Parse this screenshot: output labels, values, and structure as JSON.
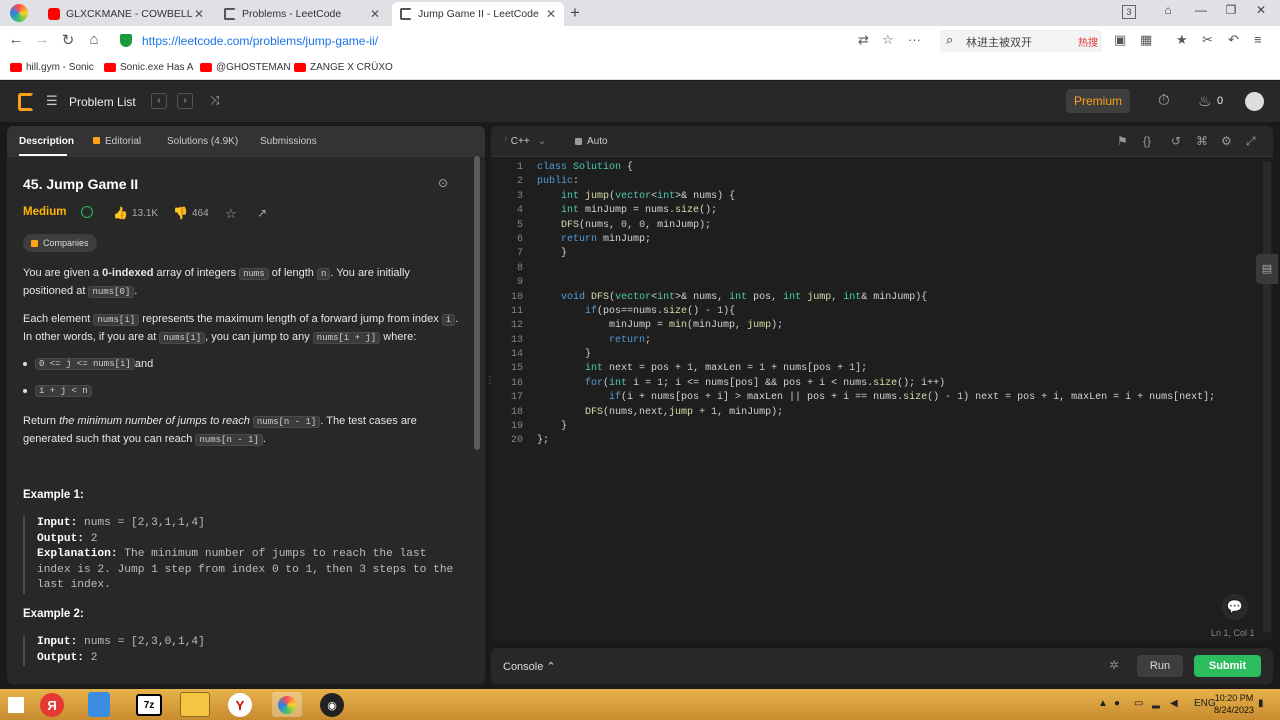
{
  "browser": {
    "tabs": [
      {
        "label": "GLXCKMANE - COWBELL",
        "active": false
      },
      {
        "label": "Problems - LeetCode",
        "active": false
      },
      {
        "label": "Jump Game II - LeetCode",
        "active": true
      }
    ],
    "url": "https://leetcode.com/problems/jump-game-ii/",
    "search_text": "林进主被双开",
    "search_hot": "热搜",
    "tab_count": "3",
    "bookmarks": [
      "hill.gym - Sonic",
      "Sonic.exe Has A",
      "@GHOSTEMAN",
      "ZANGE X CRÜXO"
    ]
  },
  "lc_nav": {
    "problem_list": "Problem List",
    "premium": "Premium",
    "streak": "0"
  },
  "left_tabs": [
    "Description",
    "Editorial",
    "Solutions (4.9K)",
    "Submissions"
  ],
  "problem": {
    "title": "45. Jump Game II",
    "difficulty": "Medium",
    "likes": "13.1K",
    "dislikes": "464",
    "companies": "Companies",
    "p1_a": "You are given a ",
    "p1_b": "0-indexed",
    "p1_c": " array of integers ",
    "p1_d": "nums",
    "p1_e": " of length ",
    "p1_f": "n",
    "p1_g": ". You are initially positioned at ",
    "p1_h": "nums[0]",
    "p1_i": ".",
    "p2_a": "Each element ",
    "p2_b": "nums[i]",
    "p2_c": " represents the maximum length of a forward jump from index ",
    "p2_d": "i",
    "p2_e": ". In other words, if you are at ",
    "p2_f": "nums[i]",
    "p2_g": ", you can jump to any ",
    "p2_h": "nums[i + j]",
    "p2_i": " where:",
    "b1_code": "0 <= j <= nums[i]",
    "b1_text": " and",
    "b2_code": "i + j < n",
    "p3_a": "Return ",
    "p3_b": "the minimum number of jumps to reach",
    "p3_c": " ",
    "p3_d": "nums[n - 1]",
    "p3_e": ". The test cases are generated such that you can reach ",
    "p3_f": "nums[n - 1]",
    "p3_g": ".",
    "ex1_title": "Example 1:",
    "ex1_input_label": "Input:",
    "ex1_input": " nums = [2,3,1,1,4]",
    "ex1_output_label": "Output:",
    "ex1_output": " 2",
    "ex1_expl_label": "Explanation:",
    "ex1_expl": " The minimum number of jumps to reach the last index is 2. Jump 1 step from index 0 to 1, then 3 steps to the last index.",
    "ex2_title": "Example 2:",
    "ex2_input_label": "Input:",
    "ex2_input": " nums = [2,3,0,1,4]",
    "ex2_output_label": "Output:",
    "ex2_output": " 2"
  },
  "editor": {
    "language": "C++",
    "auto": "Auto",
    "cursor": "Ln 1, Col 1",
    "lines": [
      "class Solution {",
      "public:",
      "    int jump(vector<int>& nums) {",
      "    int minJump = nums.size();",
      "    DFS(nums, 0, 0, minJump);",
      "    return minJump;",
      "    }",
      "",
      "",
      "    void DFS(vector<int>& nums, int pos, int jump, int& minJump){",
      "        if(pos==nums.size() - 1){",
      "            minJump = min(minJump, jump);",
      "            return;",
      "        }",
      "        int next = pos + 1, maxLen = 1 + nums[pos + 1];",
      "        for(int i = 1; i <= nums[pos] && pos + i < nums.size(); i++)",
      "            if(i + nums[pos + i] > maxLen || pos + i == nums.size() - 1) next = pos + i, maxLen = i + nums[next];",
      "        DFS(nums,next,jump + 1, minJump);",
      "    }",
      "};"
    ]
  },
  "console": {
    "label": "Console",
    "run": "Run",
    "submit": "Submit"
  },
  "taskbar": {
    "lang": "ENG",
    "time": "10:20 PM",
    "date": "8/24/2023"
  },
  "colors": {
    "accent": "#ffa116",
    "medium": "#ffb800",
    "submit": "#2cbb5d",
    "keyword": "#569cd6",
    "type": "#4ec9b0",
    "func": "#dcdcaa",
    "number": "#b5cea8"
  }
}
